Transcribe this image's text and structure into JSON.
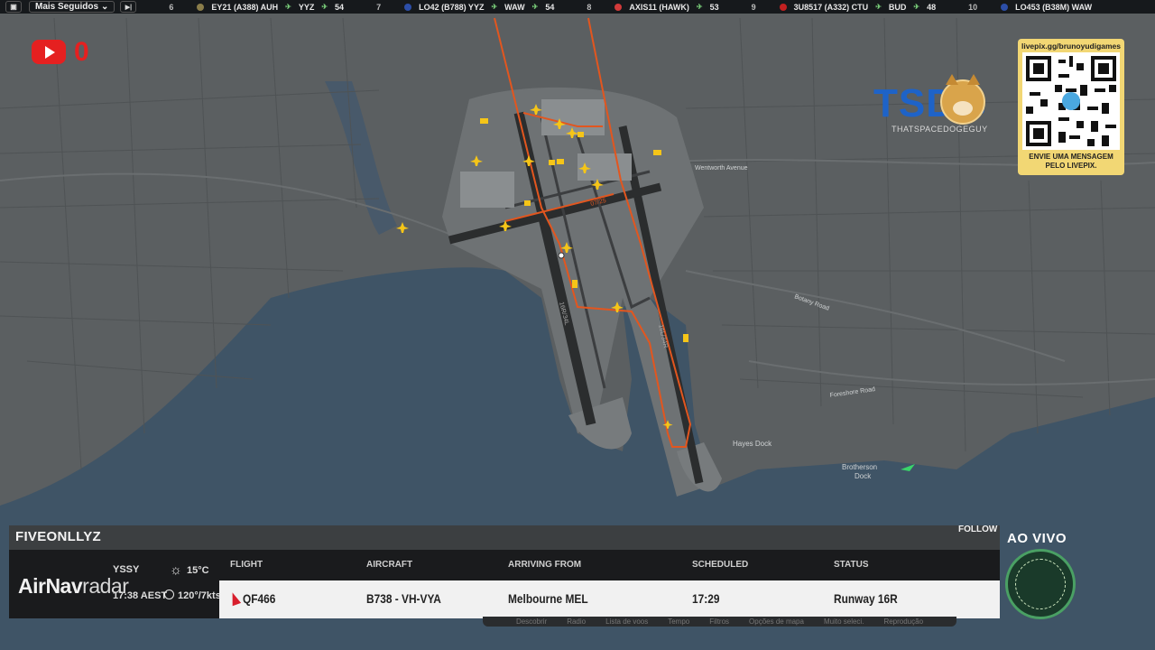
{
  "topbar": {
    "menu_icon": "window-icon",
    "dropdown_label": "Mais Seguidos",
    "skip_icon": "skip-icon",
    "flights": [
      {
        "rank": "6",
        "text": "EY21 (A388) AUH",
        "to": "YYZ",
        "count": "54",
        "logo_color": "#8a7d4a"
      },
      {
        "rank": "7",
        "text": "LO42 (B788) YYZ",
        "to": "WAW",
        "count": "54",
        "logo_color": "#2c4ea8"
      },
      {
        "rank": "8",
        "text": "AXIS11 (HAWK)",
        "to": "",
        "count": "53",
        "logo_color": "#d23a3a"
      },
      {
        "rank": "9",
        "text": "3U8517 (A332) CTU",
        "to": "BUD",
        "count": "48",
        "logo_color": "#c22020"
      },
      {
        "rank": "10",
        "text": "LO453 (B38M) WAW",
        "to": "",
        "count": "",
        "logo_color": "#2c4ea8"
      }
    ]
  },
  "overlay": {
    "youtube_count": "0",
    "tsdg_logo": "TSDG",
    "tsdg_sub": "THATSPACEDOGEGUY",
    "qr_url": "livepix.gg/brunoyudigames",
    "qr_caption_1": "ENVIE UMA MENSAGEM",
    "qr_caption_2": "PELO LIVEPIX.",
    "ao_vivo": "AO VIVO"
  },
  "map": {
    "labels": {
      "hayes_dock": "Hayes Dock",
      "brotherson_dock_1": "Brotherson",
      "brotherson_dock_2": "Dock",
      "runway_16r": "16R/34L",
      "runway_16l": "16L/34R",
      "runway_07": "07/25",
      "wentworth": "Wentworth Avenue",
      "foreshore": "Foreshore Road",
      "botany": "Botany Road"
    }
  },
  "flight_panel": {
    "callsign": "FIVEONLLYZ",
    "follow_label": "FOLLOW",
    "brand_bold": "AirNav",
    "brand_light": "radar",
    "station": "YSSY",
    "local_time": "17:38 AEST",
    "temperature": "15°C",
    "wind": "120°/7kts",
    "headers": {
      "flight": "FLIGHT",
      "aircraft": "AIRCRAFT",
      "arriving": "ARRIVING FROM",
      "scheduled": "SCHEDULED",
      "status": "STATUS"
    },
    "row": {
      "flight": "QF466",
      "aircraft": "B738 - VH-VYA",
      "arriving": "Melbourne MEL",
      "scheduled": "17:29",
      "status": "Runway 16R"
    }
  },
  "hidden_nav": [
    "Descobrir",
    "Radio",
    "Lista de voos",
    "Tempo",
    "Filtros",
    "Opções de mapa",
    "Muito seleci.",
    "Reprodução"
  ]
}
